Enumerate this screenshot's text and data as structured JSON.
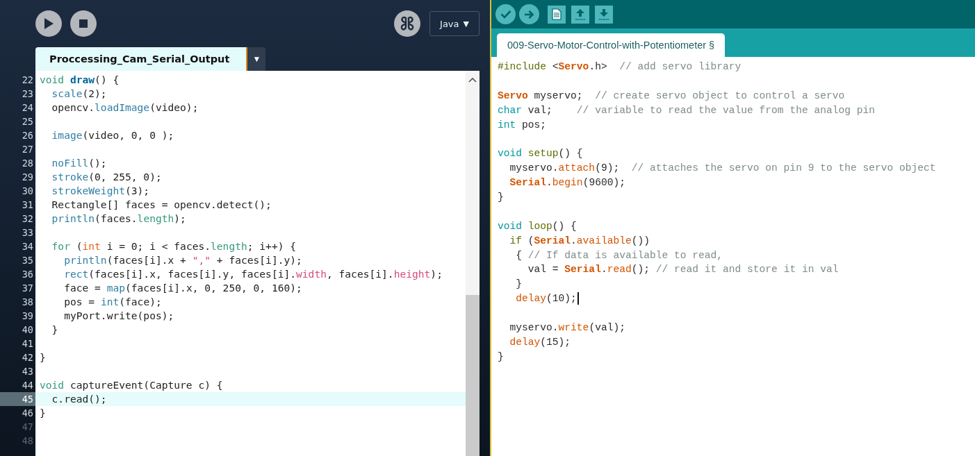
{
  "processing": {
    "toolbar": {
      "mode": "Java",
      "mode_caret": "▼"
    },
    "tabs": [
      {
        "label": "Proccessing_Cam_Serial_Output",
        "selected": true
      }
    ],
    "tab_menu": "▼",
    "lines": [
      {
        "number": "22",
        "current": false,
        "dim": false,
        "tokens": [
          {
            "text": "void ",
            "kind": "keyword"
          },
          {
            "text": "draw",
            "kind": "funcdef"
          },
          {
            "text": "() {",
            "kind": "plain"
          }
        ]
      },
      {
        "number": "23",
        "current": false,
        "dim": false,
        "tokens": [
          {
            "text": "  scale",
            "kind": "func"
          },
          {
            "text": "(2);",
            "kind": "plain"
          }
        ]
      },
      {
        "number": "24",
        "current": false,
        "dim": false,
        "tokens": [
          {
            "text": "  opencv.",
            "kind": "plain"
          },
          {
            "text": "loadImage",
            "kind": "func"
          },
          {
            "text": "(video);",
            "kind": "plain"
          }
        ]
      },
      {
        "number": "25",
        "current": false,
        "dim": false
      },
      {
        "number": "26",
        "current": false,
        "dim": false,
        "tokens": [
          {
            "text": "  image",
            "kind": "func"
          },
          {
            "text": "(video, 0, 0 );",
            "kind": "plain"
          }
        ]
      },
      {
        "number": "27",
        "current": false,
        "dim": false
      },
      {
        "number": "28",
        "current": false,
        "dim": false,
        "tokens": [
          {
            "text": "  noFill",
            "kind": "func"
          },
          {
            "text": "();",
            "kind": "plain"
          }
        ]
      },
      {
        "number": "29",
        "current": false,
        "dim": false,
        "tokens": [
          {
            "text": "  stroke",
            "kind": "func"
          },
          {
            "text": "(0, 255, 0);",
            "kind": "plain"
          }
        ]
      },
      {
        "number": "30",
        "current": false,
        "dim": false,
        "tokens": [
          {
            "text": "  strokeWeight",
            "kind": "func"
          },
          {
            "text": "(3);",
            "kind": "plain"
          }
        ]
      },
      {
        "number": "31",
        "current": false,
        "dim": false,
        "tokens": [
          {
            "text": "  Rectangle[] faces = opencv.detect();",
            "kind": "plain"
          }
        ]
      },
      {
        "number": "32",
        "current": false,
        "dim": false,
        "tokens": [
          {
            "text": "  println",
            "kind": "func"
          },
          {
            "text": "(faces.",
            "kind": "plain"
          },
          {
            "text": "length",
            "kind": "field"
          },
          {
            "text": ");",
            "kind": "plain"
          }
        ]
      },
      {
        "number": "33",
        "current": false,
        "dim": false
      },
      {
        "number": "34",
        "current": false,
        "dim": false,
        "tokens": [
          {
            "text": "  for",
            "kind": "keyword"
          },
          {
            "text": " (",
            "kind": "plain"
          },
          {
            "text": "int",
            "kind": "type"
          },
          {
            "text": " i = 0; i < faces.",
            "kind": "plain"
          },
          {
            "text": "length",
            "kind": "field"
          },
          {
            "text": "; i++) {",
            "kind": "plain"
          }
        ]
      },
      {
        "number": "35",
        "current": false,
        "dim": false,
        "tokens": [
          {
            "text": "    println",
            "kind": "func"
          },
          {
            "text": "(faces[i].x + ",
            "kind": "plain"
          },
          {
            "text": "\",\"",
            "kind": "string"
          },
          {
            "text": " + faces[i].y);",
            "kind": "plain"
          }
        ]
      },
      {
        "number": "36",
        "current": false,
        "dim": false,
        "tokens": [
          {
            "text": "    rect",
            "kind": "func"
          },
          {
            "text": "(faces[i].x, faces[i].y, faces[i].",
            "kind": "plain"
          },
          {
            "text": "width",
            "kind": "prop"
          },
          {
            "text": ", faces[i].",
            "kind": "plain"
          },
          {
            "text": "height",
            "kind": "prop"
          },
          {
            "text": ");",
            "kind": "plain"
          }
        ]
      },
      {
        "number": "37",
        "current": false,
        "dim": false,
        "tokens": [
          {
            "text": "    face = ",
            "kind": "plain"
          },
          {
            "text": "map",
            "kind": "func"
          },
          {
            "text": "(faces[i].x, 0, 250, 0, 160);",
            "kind": "plain"
          }
        ]
      },
      {
        "number": "38",
        "current": false,
        "dim": false,
        "tokens": [
          {
            "text": "    pos = ",
            "kind": "plain"
          },
          {
            "text": "int",
            "kind": "func"
          },
          {
            "text": "(face);",
            "kind": "plain"
          }
        ]
      },
      {
        "number": "39",
        "current": false,
        "dim": false,
        "tokens": [
          {
            "text": "    myPort.write(pos);",
            "kind": "plain"
          }
        ]
      },
      {
        "number": "40",
        "current": false,
        "dim": false,
        "tokens": [
          {
            "text": "  }",
            "kind": "plain"
          }
        ]
      },
      {
        "number": "41",
        "current": false,
        "dim": false
      },
      {
        "number": "42",
        "current": false,
        "dim": false,
        "tokens": [
          {
            "text": "}",
            "kind": "plain"
          }
        ]
      },
      {
        "number": "43",
        "current": false,
        "dim": false
      },
      {
        "number": "44",
        "current": false,
        "dim": false,
        "tokens": [
          {
            "text": "void ",
            "kind": "keyword"
          },
          {
            "text": "captureEvent(Capture c) {",
            "kind": "plain"
          }
        ]
      },
      {
        "number": "45",
        "current": true,
        "dim": false,
        "tokens": [
          {
            "text": "  c.read();",
            "kind": "plain"
          }
        ]
      },
      {
        "number": "46",
        "current": false,
        "dim": false,
        "tokens": [
          {
            "text": "}",
            "kind": "plain"
          }
        ]
      },
      {
        "number": "47",
        "current": false,
        "dim": true
      },
      {
        "number": "48",
        "current": false,
        "dim": true
      }
    ]
  },
  "arduino": {
    "tabs": [
      {
        "label": "009-Servo-Motor-Control-with-Potentiometer §",
        "selected": true
      }
    ],
    "lines": [
      {
        "caret": false,
        "tokens": [
          {
            "text": "#include",
            "kind": "pre"
          },
          {
            "text": " <",
            "kind": "plain"
          },
          {
            "text": "Servo",
            "kind": "class"
          },
          {
            "text": ".h>  ",
            "kind": "plain"
          },
          {
            "text": "// add servo library",
            "kind": "comment"
          }
        ]
      },
      {
        "caret": false
      },
      {
        "caret": false,
        "tokens": [
          {
            "text": "Servo",
            "kind": "class"
          },
          {
            "text": " myservo;  ",
            "kind": "plain"
          },
          {
            "text": "// create servo object to control a servo",
            "kind": "comment"
          }
        ]
      },
      {
        "caret": false,
        "tokens": [
          {
            "text": "char",
            "kind": "type"
          },
          {
            "text": " val;    ",
            "kind": "plain"
          },
          {
            "text": "// variable to read the value from the analog pin",
            "kind": "comment"
          }
        ]
      },
      {
        "caret": false,
        "tokens": [
          {
            "text": "int",
            "kind": "type"
          },
          {
            "text": " pos;",
            "kind": "plain"
          }
        ]
      },
      {
        "caret": false
      },
      {
        "caret": false,
        "tokens": [
          {
            "text": "void ",
            "kind": "type"
          },
          {
            "text": "setup",
            "kind": "fn"
          },
          {
            "text": "() {",
            "kind": "plain"
          }
        ]
      },
      {
        "caret": false,
        "tokens": [
          {
            "text": "  myservo.",
            "kind": "plain"
          },
          {
            "text": "attach",
            "kind": "func"
          },
          {
            "text": "(9);  ",
            "kind": "plain"
          },
          {
            "text": "// attaches the servo on pin 9 to the servo object",
            "kind": "comment"
          }
        ]
      },
      {
        "caret": false,
        "tokens": [
          {
            "text": "  Serial",
            "kind": "class"
          },
          {
            "text": ".",
            "kind": "plain"
          },
          {
            "text": "begin",
            "kind": "func"
          },
          {
            "text": "(9600);",
            "kind": "plain"
          }
        ]
      },
      {
        "caret": false,
        "tokens": [
          {
            "text": "}",
            "kind": "plain"
          }
        ]
      },
      {
        "caret": false
      },
      {
        "caret": false,
        "tokens": [
          {
            "text": "void ",
            "kind": "type"
          },
          {
            "text": "loop",
            "kind": "fn"
          },
          {
            "text": "() {",
            "kind": "plain"
          }
        ]
      },
      {
        "caret": false,
        "tokens": [
          {
            "text": "  if",
            "kind": "kw"
          },
          {
            "text": " (",
            "kind": "plain"
          },
          {
            "text": "Serial",
            "kind": "class"
          },
          {
            "text": ".",
            "kind": "plain"
          },
          {
            "text": "available",
            "kind": "func"
          },
          {
            "text": "())",
            "kind": "plain"
          }
        ]
      },
      {
        "caret": false,
        "tokens": [
          {
            "text": "   { ",
            "kind": "plain"
          },
          {
            "text": "// If data is available to read,",
            "kind": "comment"
          }
        ]
      },
      {
        "caret": false,
        "tokens": [
          {
            "text": "     val = ",
            "kind": "plain"
          },
          {
            "text": "Serial",
            "kind": "class"
          },
          {
            "text": ".",
            "kind": "plain"
          },
          {
            "text": "read",
            "kind": "func"
          },
          {
            "text": "(); ",
            "kind": "plain"
          },
          {
            "text": "// read it and store it in val",
            "kind": "comment"
          }
        ]
      },
      {
        "caret": false,
        "tokens": [
          {
            "text": "   }",
            "kind": "plain"
          }
        ]
      },
      {
        "caret": true,
        "tokens": [
          {
            "text": "   delay",
            "kind": "func"
          },
          {
            "text": "(10);",
            "kind": "plain"
          }
        ]
      },
      {
        "caret": false
      },
      {
        "caret": false,
        "tokens": [
          {
            "text": "  myservo.",
            "kind": "plain"
          },
          {
            "text": "write",
            "kind": "func"
          },
          {
            "text": "(val);",
            "kind": "plain"
          }
        ]
      },
      {
        "caret": false,
        "tokens": [
          {
            "text": "  delay",
            "kind": "func"
          },
          {
            "text": "(15);",
            "kind": "plain"
          }
        ]
      },
      {
        "caret": false,
        "tokens": [
          {
            "text": "}",
            "kind": "plain"
          }
        ]
      }
    ]
  }
}
